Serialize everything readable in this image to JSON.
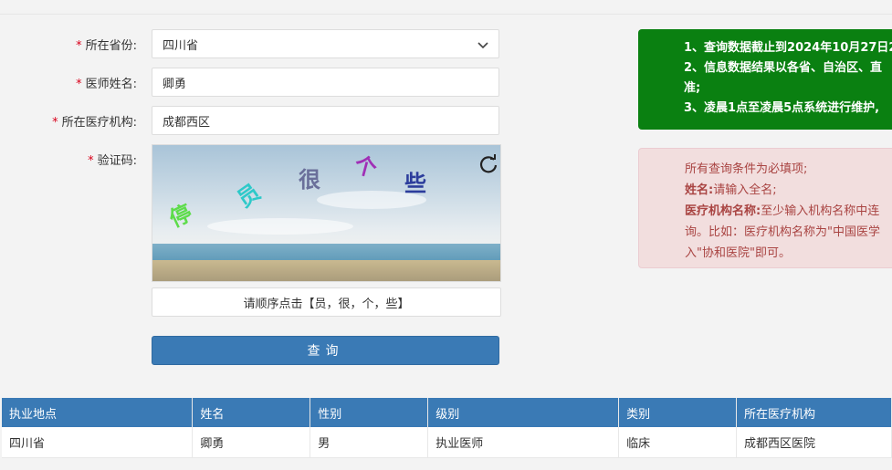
{
  "form": {
    "province_label": "所在省份:",
    "province_value": "四川省",
    "name_label": "医师姓名:",
    "name_value": "卿勇",
    "institution_label": "所在医疗机构:",
    "institution_value": "成都西区",
    "captcha_label": "验证码:",
    "required_mark": "*",
    "captcha_chars": [
      "停",
      "员",
      "很",
      "个",
      "些"
    ],
    "captcha_hint": "请顺序点击【员，很，个，些】",
    "query_button": "查询"
  },
  "notice_green": {
    "line1": "1、查询数据截止到2024年10月27日2",
    "line2": "2、信息数据结果以各省、自治区、直",
    "line3": "准;",
    "line4": "3、凌晨1点至凌晨5点系统进行维护,"
  },
  "notice_red": {
    "line1": "所有查询条件为必填项;",
    "line2_bold": "姓名:",
    "line2_text": "请输入全名;",
    "line3_bold": "医疗机构名称:",
    "line3_text": "至少输入机构名称中连",
    "line4": "询。比如：医疗机构名称为\"中国医学",
    "line5": "入\"协和医院\"即可。"
  },
  "table": {
    "headers": [
      "执业地点",
      "姓名",
      "性别",
      "级别",
      "类别",
      "所在医疗机构"
    ],
    "rows": [
      [
        "四川省",
        "卿勇",
        "男",
        "执业医师",
        "临床",
        "成都西区医院"
      ]
    ]
  },
  "colors": {
    "primary": "#3a7ab5",
    "notice_green": "#0a8011",
    "notice_red_bg": "#f2dede",
    "required": "#d9001b"
  }
}
